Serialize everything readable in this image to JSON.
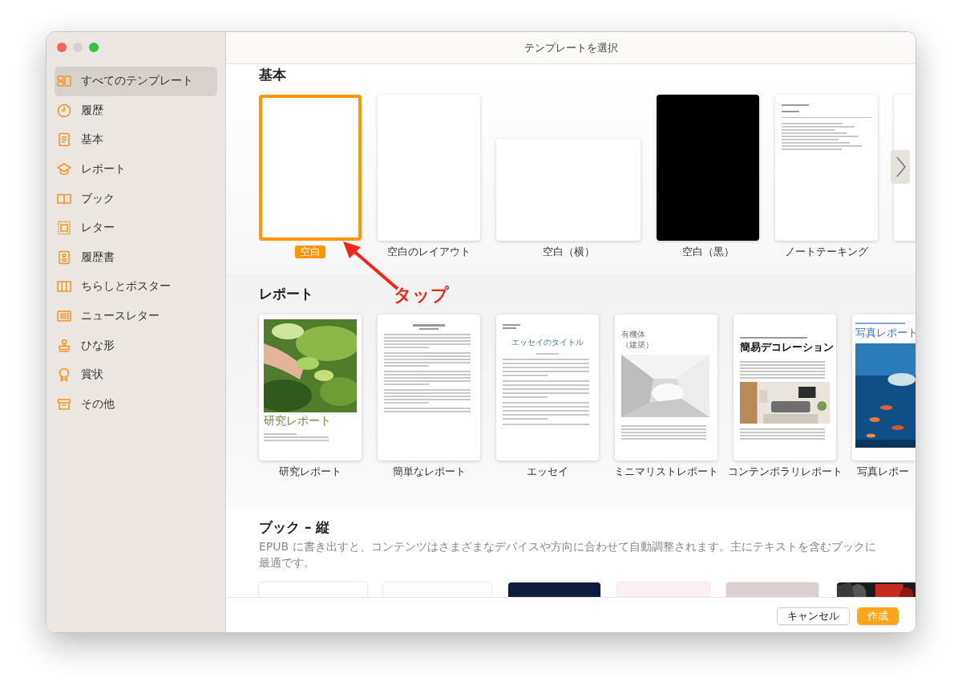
{
  "window": {
    "title": "テンプレートを選択"
  },
  "sidebar": {
    "items": [
      {
        "label": "すべてのテンプレート",
        "selected": true
      },
      {
        "label": "履歴",
        "selected": false
      },
      {
        "label": "基本",
        "selected": false
      },
      {
        "label": "レポート",
        "selected": false
      },
      {
        "label": "ブック",
        "selected": false
      },
      {
        "label": "レター",
        "selected": false
      },
      {
        "label": "履歴書",
        "selected": false
      },
      {
        "label": "ちらしとポスター",
        "selected": false
      },
      {
        "label": "ニュースレター",
        "selected": false
      },
      {
        "label": "ひな形",
        "selected": false
      },
      {
        "label": "賞状",
        "selected": false
      },
      {
        "label": "その他",
        "selected": false
      }
    ]
  },
  "sections": [
    {
      "title": "基本",
      "templates": [
        {
          "label": "空白",
          "kind": "blank",
          "selected": true
        },
        {
          "label": "空白のレイアウト",
          "kind": "blank",
          "selected": false
        },
        {
          "label": "空白（横）",
          "kind": "landscape",
          "selected": false
        },
        {
          "label": "空白（黒）",
          "kind": "black",
          "selected": false
        },
        {
          "label": "ノートテーキング",
          "kind": "notes",
          "selected": false
        },
        {
          "kind": "partial",
          "selected": false
        }
      ]
    },
    {
      "title": "レポート",
      "templates": [
        {
          "label": "研究レポート",
          "kind": "photo-cover",
          "cover_title": "研究レポート",
          "selected": false
        },
        {
          "label": "簡単なレポート",
          "kind": "text",
          "selected": false
        },
        {
          "label": "エッセイ",
          "kind": "essay",
          "cover_title": "エッセイのタイトル",
          "selected": false
        },
        {
          "label": "ミニマリストレポート",
          "kind": "minimal",
          "cover_title": "有機体（建築）",
          "selected": false
        },
        {
          "label": "コンテンポラリレポート",
          "kind": "contemporary",
          "cover_title": "簡易デコレーション",
          "selected": false
        },
        {
          "label": "写真レポー",
          "kind": "photo-partial",
          "cover_title": "写真レポート",
          "selected": false
        }
      ]
    },
    {
      "title": "ブック – 縦",
      "description": "EPUB に書き出すと、コンテンツはさまざまなデバイスや方向に合わせて自動調整されます。主にテキストを含むブックに最適です。",
      "templates": [
        {
          "kind": "book",
          "color": "#ffffff",
          "selected": false
        },
        {
          "kind": "book",
          "color": "#fffdfb",
          "selected": false
        },
        {
          "kind": "book",
          "color": "#0f1c3f",
          "selected": false
        },
        {
          "kind": "book",
          "color": "#fcf0f6",
          "selected": false
        },
        {
          "kind": "book",
          "color": "#dccfcf",
          "selected": false
        },
        {
          "kind": "book-picture",
          "selected": false
        }
      ]
    }
  ],
  "buttons": [
    {
      "label": "キャンセル",
      "kind": "secondary"
    },
    {
      "label": "作成",
      "kind": "primary"
    }
  ],
  "annotation": {
    "text": "タップ"
  }
}
